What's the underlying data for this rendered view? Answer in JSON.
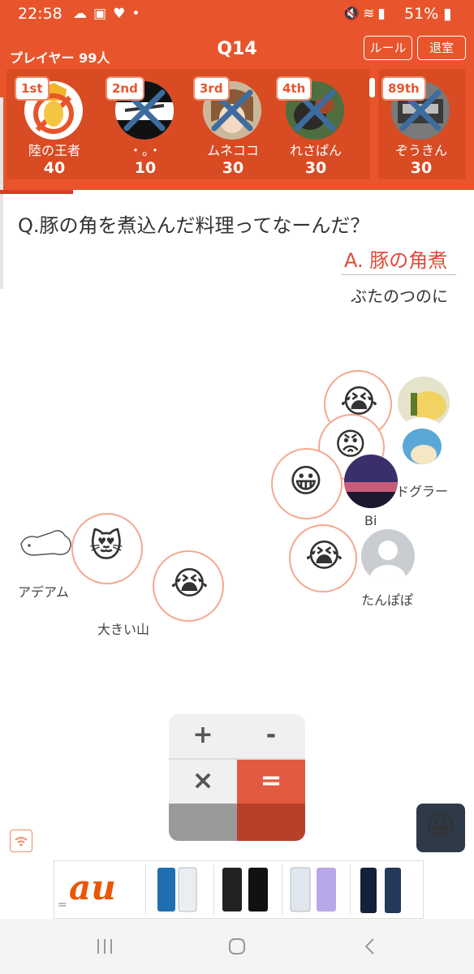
{
  "status_bar": {
    "time": "22:58",
    "left_icons": [
      "cloud-icon",
      "image-icon",
      "heart-icon",
      "dot-icon"
    ],
    "right_icons": [
      "mute-icon",
      "wifi-icon",
      "signal-icon"
    ],
    "battery": "51%"
  },
  "header": {
    "players_label": "プレイヤー 99人",
    "question_number": "Q14",
    "rules_button": "ルール",
    "exit_button": "退室"
  },
  "ranking": [
    {
      "rank": "1st",
      "name": "陸の王者",
      "score": "40",
      "eliminated": false
    },
    {
      "rank": "2nd",
      "name": "・。・",
      "score": "10",
      "eliminated": true
    },
    {
      "rank": "3rd",
      "name": "ムネココ",
      "score": "30",
      "eliminated": true
    },
    {
      "rank": "4th",
      "name": "れさぱん",
      "score": "30",
      "eliminated": true
    },
    {
      "rank": "89th",
      "name": "ぞうきん",
      "score": "30",
      "eliminated": true
    }
  ],
  "quiz": {
    "question": "Q.豚の角を煮込んだ料理ってなーんだ？",
    "answer": "A. 豚の角煮",
    "reading": "ぶたのつのに"
  },
  "reactions": [
    {
      "user": "ドグラー",
      "emoji": "😭"
    },
    {
      "user": "",
      "emoji": "😡"
    },
    {
      "user": "Bi",
      "emoji": "😀"
    },
    {
      "user": "たんぽぽ",
      "emoji": "😭"
    },
    {
      "user": "アデアム",
      "emoji": "😻"
    },
    {
      "user": "大きい山",
      "emoji": "😭"
    }
  ],
  "calculator": {
    "plus": "+",
    "minus": "-",
    "times": "×",
    "equals": "="
  },
  "emoji_button": "😀",
  "ad": {
    "brand": "au",
    "equals_mark": "="
  },
  "colors": {
    "header": "#e8552c",
    "accent_red": "#e04a3a",
    "badge_border": "#f08a6b"
  }
}
